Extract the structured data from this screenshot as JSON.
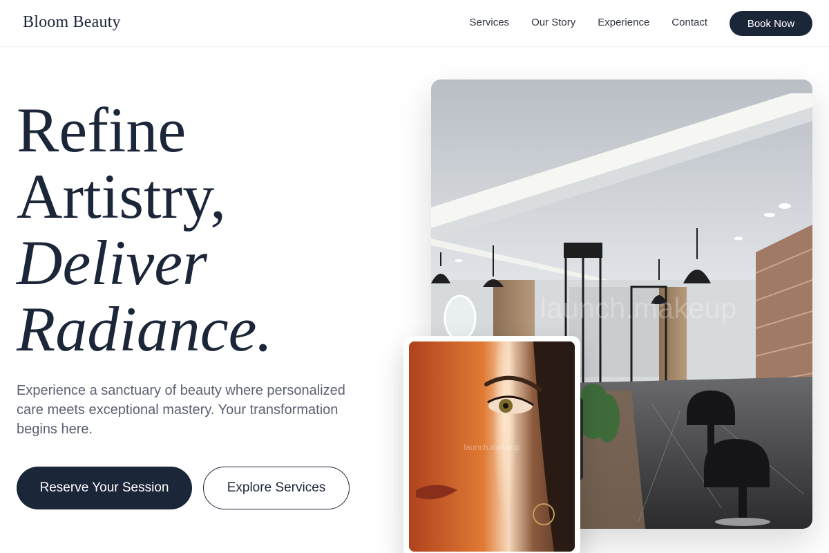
{
  "brand": {
    "name": "Bloom Beauty"
  },
  "nav": {
    "links": [
      "Services",
      "Our Story",
      "Experience",
      "Contact"
    ],
    "cta": "Book Now"
  },
  "hero": {
    "headline": {
      "line1": "Refine",
      "line2": "Artistry,",
      "line3": "Deliver",
      "line4": "Radiance."
    },
    "subtext": "Experience a sanctuary of beauty where personalized care meets exceptional mastery. Your transformation begins here.",
    "primary_cta": "Reserve Your Session",
    "secondary_cta": "Explore Services"
  },
  "images": {
    "salon_watermark": "launch.makeup",
    "portrait_watermark": "launch.makeup"
  },
  "colors": {
    "primary": "#1c2639",
    "text_muted": "#5b6170",
    "background": "#ffffff"
  }
}
